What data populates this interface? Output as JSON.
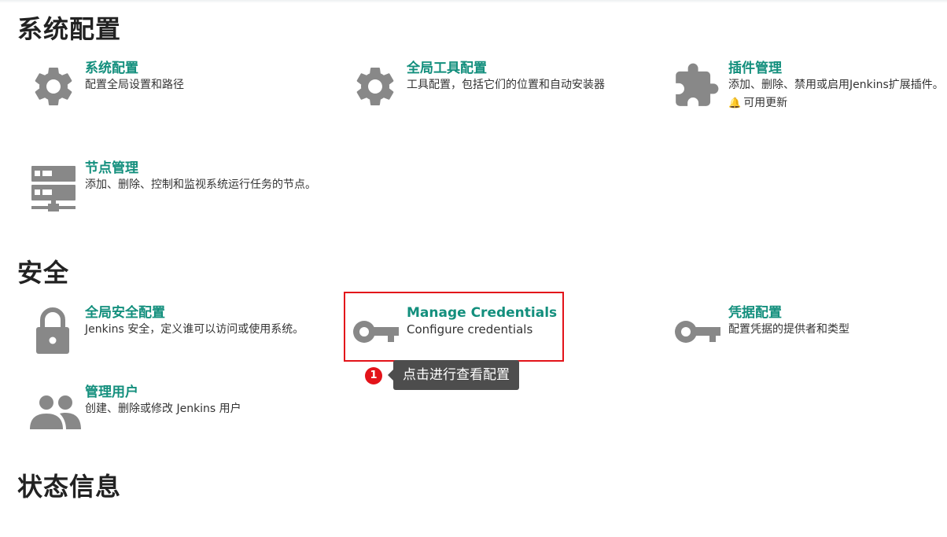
{
  "sections": {
    "system": {
      "title": "系统配置"
    },
    "security": {
      "title": "安全"
    },
    "status": {
      "title": "状态信息"
    }
  },
  "items": {
    "system_config": {
      "title": "系统配置",
      "desc": "配置全局设置和路径",
      "icon": "gear-icon"
    },
    "global_tools": {
      "title": "全局工具配置",
      "desc": "工具配置，包括它们的位置和自动安装器",
      "icon": "gear-icon"
    },
    "plugins": {
      "title": "插件管理",
      "desc": "添加、删除、禁用或启用Jenkins扩展插件。",
      "update": "可用更新",
      "icon": "puzzle-icon"
    },
    "nodes": {
      "title": "节点管理",
      "desc": "添加、删除、控制和监视系统运行任务的节点。",
      "icon": "server-icon"
    },
    "global_security": {
      "title": "全局安全配置",
      "desc": "Jenkins 安全，定义谁可以访问或使用系统。",
      "icon": "lock-icon"
    },
    "credentials": {
      "title": "Manage Credentials",
      "desc": "Configure credentials",
      "icon": "key-icon"
    },
    "credential_config": {
      "title": "凭据配置",
      "desc": "配置凭据的提供者和类型",
      "icon": "key-icon"
    },
    "users": {
      "title": "管理用户",
      "desc": "创建、删除或修改 Jenkins 用户",
      "icon": "users-icon"
    }
  },
  "annotation": {
    "badge": "1",
    "tooltip": "点击进行查看配置"
  },
  "colors": {
    "link": "#138f7d",
    "icon": "#888888",
    "highlight": "#e3131a",
    "tooltip_bg": "#4d4d4d"
  }
}
